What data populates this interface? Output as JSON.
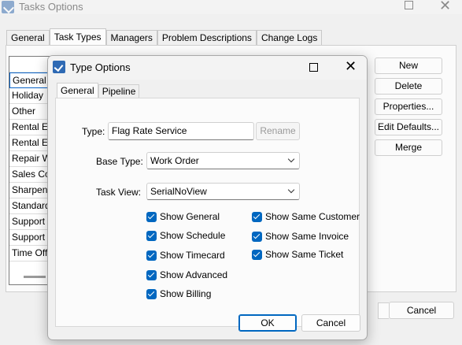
{
  "background_window": {
    "title": "Tasks Options",
    "tabs": [
      "General",
      "Task Types",
      "Managers",
      "Problem Descriptions",
      "Change Logs"
    ],
    "active_tab": "Task Types",
    "task_types": [
      "General S",
      "Holiday",
      "Other",
      "Rental Eq",
      "Rental Eq",
      "Repair W",
      "Sales Cor",
      "Sharpen",
      "Standard",
      "Support",
      "Support C",
      "Time Off"
    ],
    "buttons": {
      "new": "New",
      "delete": "Delete",
      "properties": "Properties...",
      "edit_defaults": "Edit Defaults...",
      "merge": "Merge",
      "cancel": "Cancel"
    }
  },
  "dialog": {
    "title": "Type Options",
    "tabs": [
      "General",
      "Pipeline"
    ],
    "active_tab": "General",
    "type_label": "Type:",
    "type_value": "Flag Rate Service",
    "rename_label": "Rename",
    "base_type_label": "Base Type:",
    "base_type_value": "Work Order",
    "task_view_label": "Task View:",
    "task_view_value": "SerialNoView",
    "checkboxes_left": [
      {
        "label": "Show General",
        "checked": true
      },
      {
        "label": "Show Schedule",
        "checked": true
      },
      {
        "label": "Show Timecard",
        "checked": true
      },
      {
        "label": "Show Advanced",
        "checked": true
      },
      {
        "label": "Show Billing",
        "checked": true
      }
    ],
    "checkboxes_right": [
      {
        "label": "Show Same Customer",
        "checked": true
      },
      {
        "label": "Show Same Invoice",
        "checked": true
      },
      {
        "label": "Show Same Ticket",
        "checked": true
      }
    ],
    "ok_label": "OK",
    "cancel_label": "Cancel"
  },
  "colors": {
    "accent": "#0067c0",
    "app_icon": "#2f6ab4"
  }
}
